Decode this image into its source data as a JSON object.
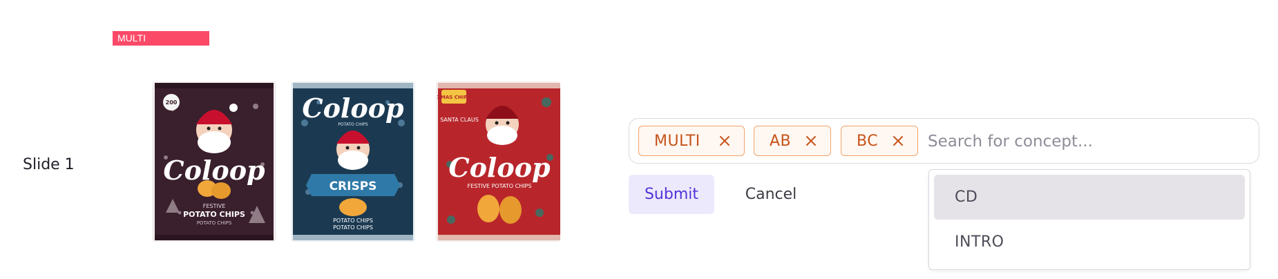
{
  "badge": {
    "label": "MULTI",
    "color": "#fb4a68"
  },
  "slide": {
    "label": "Slide 1"
  },
  "thumbnails": [
    {
      "name": "chips-bag-dark",
      "brand": "Coloop",
      "line1": "FESTIVE",
      "line2": "POTATO CHIPS",
      "line3": "POTATO CHIPS",
      "seal": "200"
    },
    {
      "name": "chips-bag-blue",
      "brand": "Coloop",
      "line1": "POTATO CHIPS",
      "banner": "CRISPS",
      "line2": "POTATO CHIPS",
      "line3": "POTATO CHIPS"
    },
    {
      "name": "chips-bag-red",
      "brand": "Coloop",
      "line1": "FESTIVE POTATO CHIPS",
      "tag": "SANTA CLAUS",
      "corner": "XMAS CHIPS"
    }
  ],
  "concepts": {
    "chips": [
      {
        "label": "MULTI",
        "remove_icon": "close-icon"
      },
      {
        "label": "AB",
        "remove_icon": "close-icon"
      },
      {
        "label": "BC",
        "remove_icon": "close-icon"
      }
    ],
    "search_placeholder": "Search for concept...",
    "search_value": "",
    "chip_color": "#c6531a"
  },
  "actions": {
    "submit_label": "Submit",
    "cancel_label": "Cancel",
    "accent": "#5331d8"
  },
  "dropdown": {
    "options": [
      {
        "label": "CD",
        "highlighted": true
      },
      {
        "label": "INTRO",
        "highlighted": false
      }
    ]
  }
}
